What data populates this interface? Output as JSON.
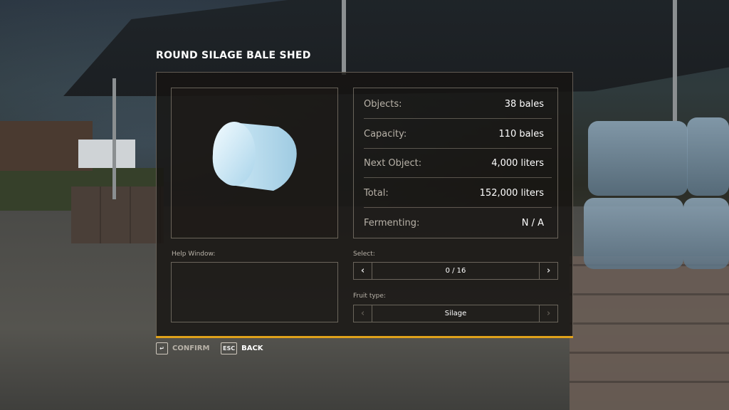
{
  "dialog": {
    "title": "ROUND SILAGE BALE SHED",
    "accent_color": "#e0a21b"
  },
  "info": [
    {
      "label": "Objects:",
      "value": "38 bales"
    },
    {
      "label": "Capacity:",
      "value": "110 bales"
    },
    {
      "label": "Next Object:",
      "value": "4,000 liters"
    },
    {
      "label": "Total:",
      "value": "152,000 liters"
    },
    {
      "label": "Fermenting:",
      "value": "N / A"
    }
  ],
  "help": {
    "label": "Help Window:"
  },
  "select": {
    "label": "Select:",
    "value": "0 / 16",
    "prev_icon": "chevron-left-icon",
    "next_icon": "chevron-right-icon"
  },
  "fruit": {
    "label": "Fruit type:",
    "value": "Silage"
  },
  "footer": {
    "confirm_key": "↵",
    "confirm_label": "CONFIRM",
    "back_key": "ESC",
    "back_label": "BACK"
  }
}
